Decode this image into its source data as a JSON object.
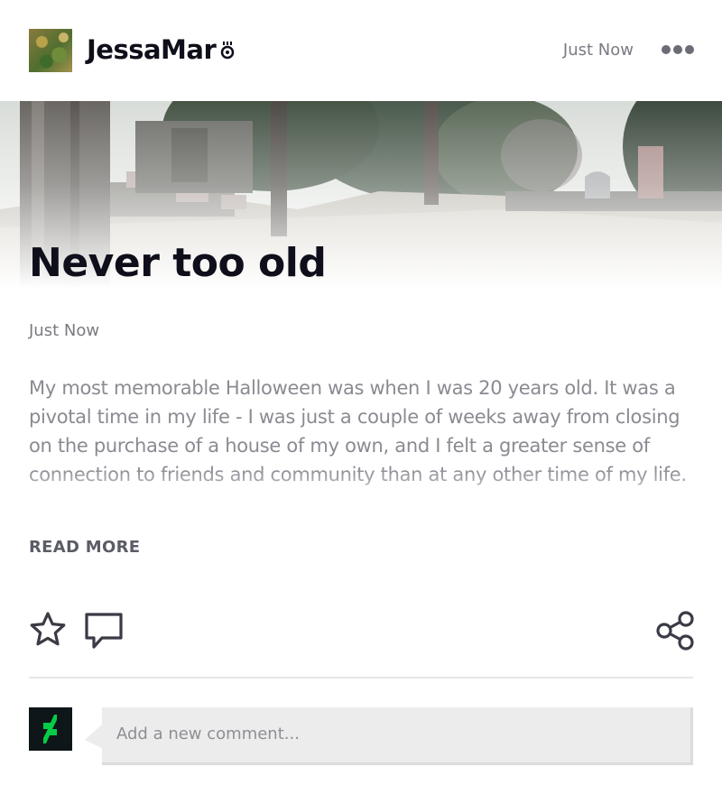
{
  "header": {
    "username": "JessaMar",
    "timestamp": "Just Now"
  },
  "post": {
    "title": "Never too old",
    "time": "Just Now",
    "body": "My most memorable Halloween was when I was 20 years old. It was a pivotal time in my life - I was just a couple of weeks away from closing on the purchase of a house of my own, and I felt a greater sense of connection to friends and community than at any other time of my life.",
    "read_more": "READ MORE"
  },
  "comment": {
    "placeholder": "Add a new comment..."
  },
  "colors": {
    "text_primary": "#0e0f1a",
    "text_muted": "#7a7b82",
    "brand_green": "#05cc47",
    "icon_gray": "#3a3b45"
  },
  "icons": [
    "user-badge-icon",
    "more-options-icon",
    "star-icon",
    "comment-icon",
    "share-icon",
    "deviantart-logo"
  ]
}
